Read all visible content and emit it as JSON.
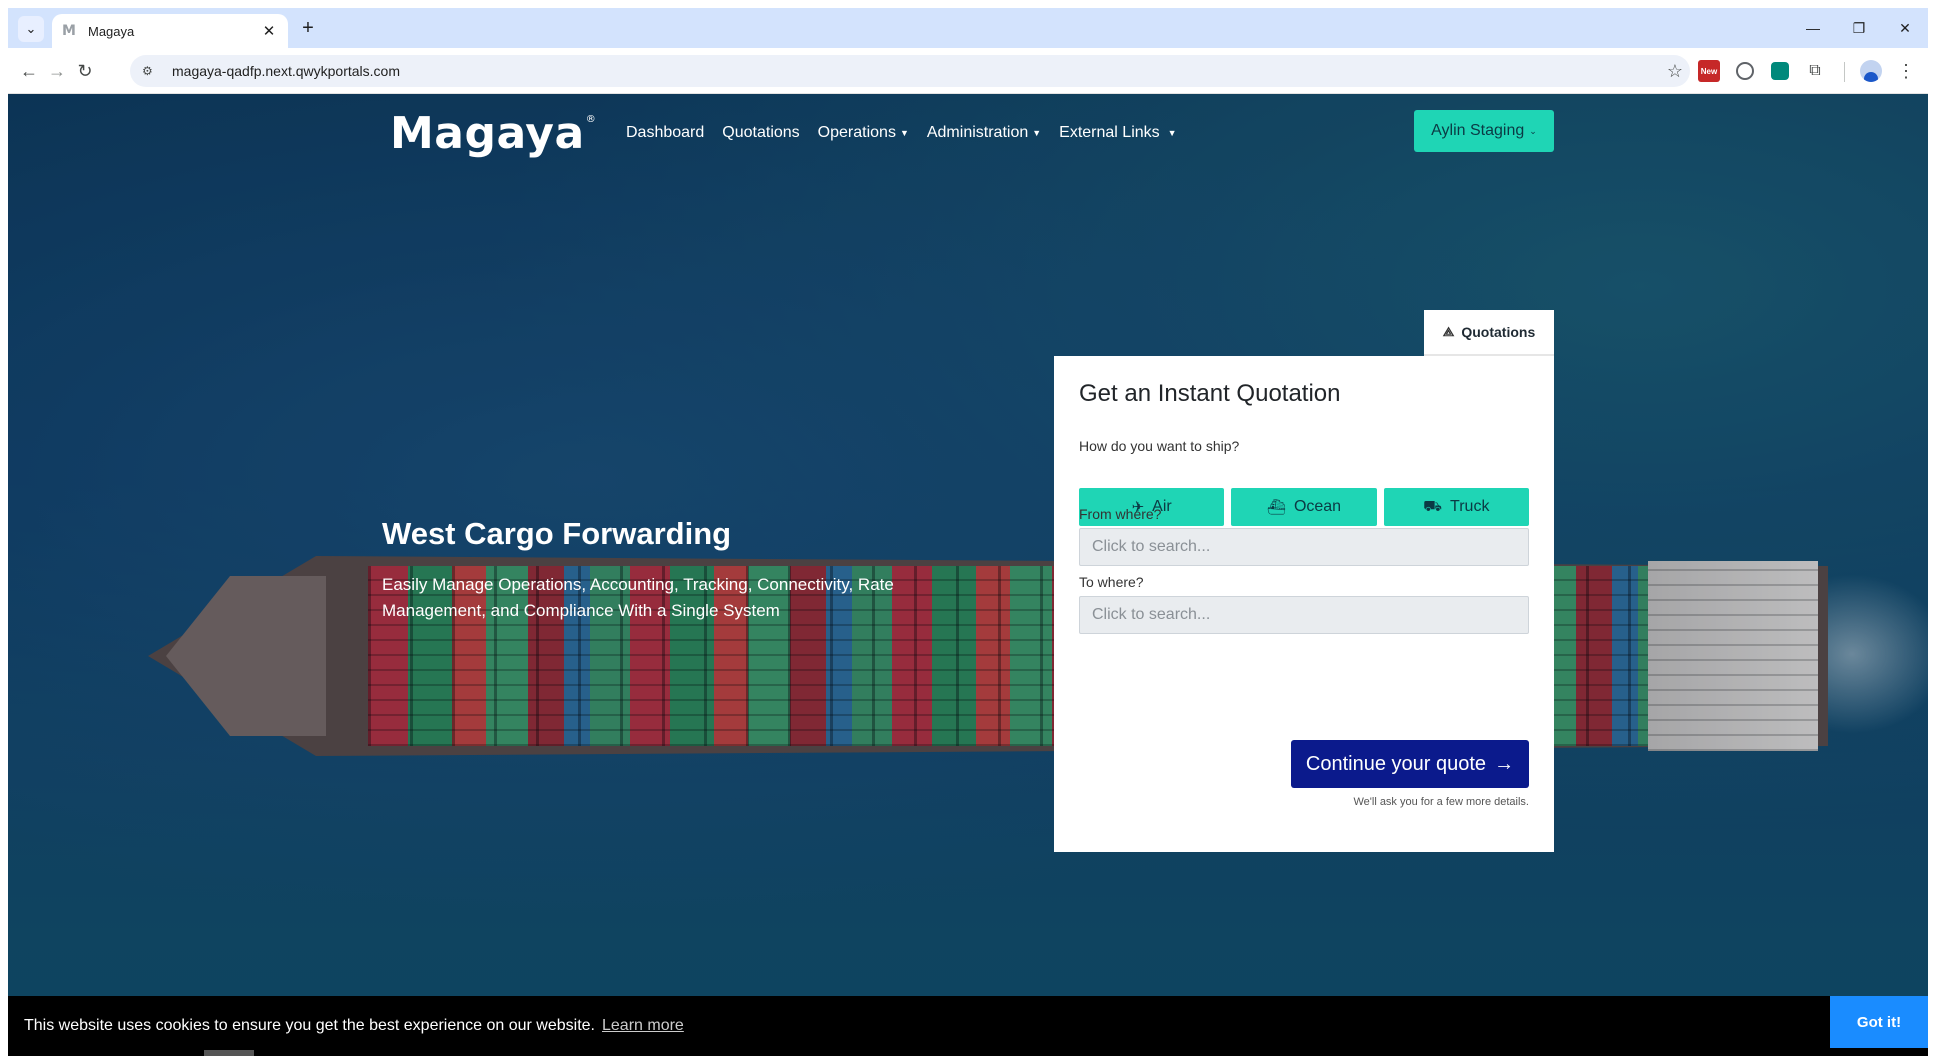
{
  "browser": {
    "tab_title": "Magaya",
    "tab_favicon": "M",
    "url": "magaya-qadfp.next.qwykportals.com",
    "ext_new_label": "New",
    "icons": [
      "tab-search-icon",
      "close-icon",
      "plus-icon",
      "minimize-icon",
      "restore-icon",
      "back-icon",
      "forward-icon",
      "reload-icon",
      "site-info-icon",
      "star-icon",
      "extensions-icon",
      "profile-icon",
      "more-icon"
    ]
  },
  "site": {
    "logo": "Magaya",
    "logo_mark": "®",
    "nav": [
      {
        "label": "Dashboard",
        "dropdown": false
      },
      {
        "label": "Quotations",
        "dropdown": false
      },
      {
        "label": "Operations",
        "dropdown": true
      },
      {
        "label": "Administration",
        "dropdown": true
      },
      {
        "label": "External Links",
        "dropdown": true
      }
    ],
    "user_menu": "Aylin Staging",
    "accent_color": "#1fd5b5",
    "primary_color": "#0b1a8c"
  },
  "hero": {
    "title": "West Cargo Forwarding",
    "subtitle": "Easily Manage Operations, Accounting, Tracking, Connectivity, Rate Management, and Compliance With a Single System"
  },
  "quote": {
    "tab_label": "Quotations",
    "title": "Get an Instant Quotation",
    "ship_question": "How do you want to ship?",
    "modes": [
      {
        "label": "Air",
        "icon": "plane-icon"
      },
      {
        "label": "Ocean",
        "icon": "ship-icon"
      },
      {
        "label": "Truck",
        "icon": "truck-icon"
      }
    ],
    "from_label": "From where?",
    "from_placeholder": "Click to search...",
    "to_label": "To where?",
    "to_placeholder": "Click to search...",
    "continue_label": "Continue your quote",
    "hint": "We'll ask you for a few more details."
  },
  "cookie": {
    "message": "This website uses cookies to ensure you get the best experience on our website.",
    "learn_more": "Learn more",
    "accept": "Got it!"
  }
}
